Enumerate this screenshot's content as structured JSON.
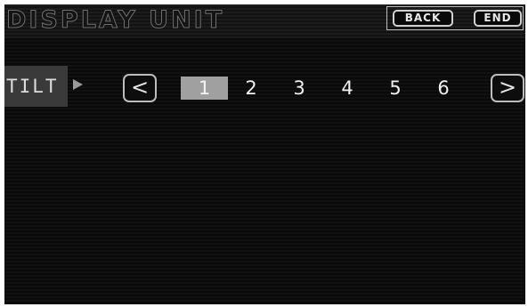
{
  "header": {
    "title": "DISPLAY UNIT",
    "back_label": "BACK",
    "end_label": "END"
  },
  "tilt": {
    "label": "TILT",
    "prev_label": "<",
    "next_label": ">",
    "selected": "1",
    "options": [
      "1",
      "2",
      "3",
      "4",
      "5",
      "6"
    ]
  },
  "colors": {
    "background": "#0d0d0d",
    "selected_highlight": "#a0a0a0",
    "label_bg": "#3a3a3a"
  },
  "icons": {
    "tilt_indicator": "triangle-right-icon"
  }
}
